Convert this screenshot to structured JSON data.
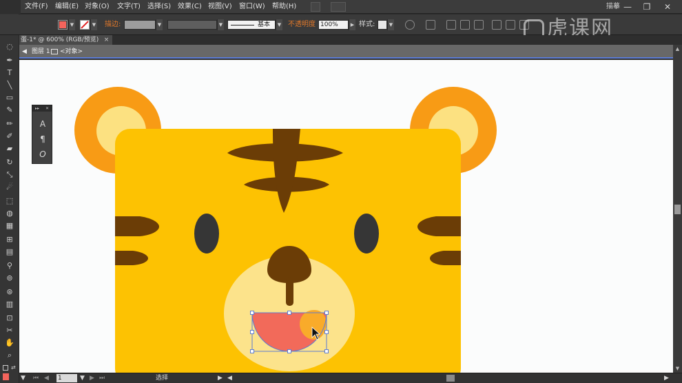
{
  "menubar": {
    "items": [
      {
        "id": "file",
        "label": "文件(F)"
      },
      {
        "id": "edit",
        "label": "编辑(E)"
      },
      {
        "id": "object",
        "label": "对象(O)"
      },
      {
        "id": "type",
        "label": "文字(T)"
      },
      {
        "id": "select",
        "label": "选择(S)"
      },
      {
        "id": "effect",
        "label": "效果(C)"
      },
      {
        "id": "view",
        "label": "视图(V)"
      },
      {
        "id": "window",
        "label": "窗口(W)"
      },
      {
        "id": "help",
        "label": "帮助(H)"
      }
    ],
    "workspace_label": "描摹"
  },
  "controlbar": {
    "fill_color": "#f4645c",
    "stroke_label": "描边:",
    "stroke_profile_label": "基本",
    "opacity_label": "不透明度",
    "opacity_value": "100%",
    "style_label": "样式:",
    "accent_label_color": "#e0782a"
  },
  "document": {
    "tab_title": "蛋-1* @ 600% (RGB/预览)",
    "tab_close": "×"
  },
  "breadcrumb": {
    "layer": "图层 1",
    "object": "<对象>"
  },
  "statusbar": {
    "page": "1",
    "mode": "选择"
  },
  "char_panel": {
    "character": "A",
    "paragraph": "¶",
    "opentype": "O"
  },
  "watermark": "虎课网",
  "colors": {
    "tiger_body": "#fdc202",
    "ear_outer": "#f89b15",
    "ear_inner": "#fce181",
    "stripe": "#6b3d06",
    "eye": "#363636",
    "muzzle": "#fce38b",
    "tongue": "#f26a5a",
    "tongue_spot": "#f9ab2a",
    "selection": "#5b7bd3",
    "canvas": "#fbfcfc"
  }
}
